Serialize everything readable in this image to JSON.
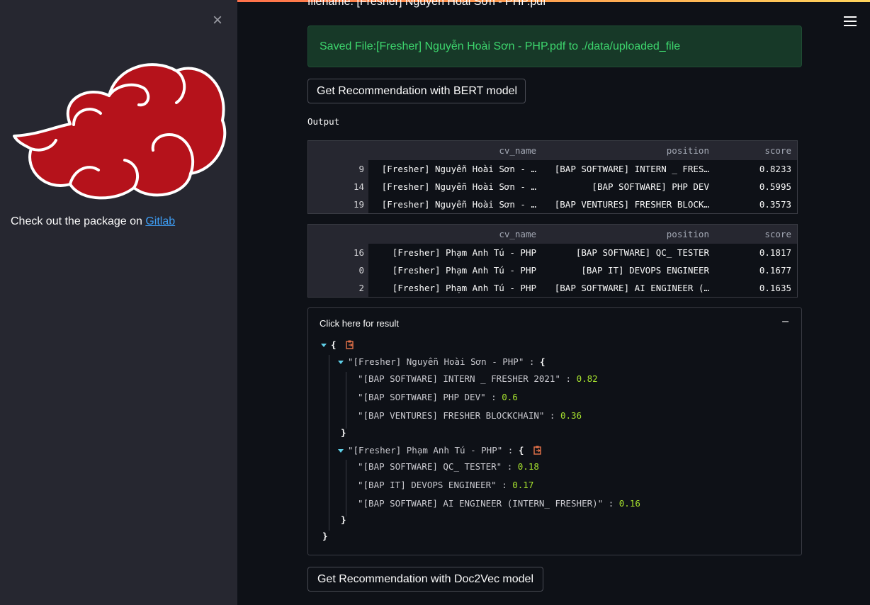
{
  "sidebar": {
    "gitlab_prefix": "Check out the package on ",
    "gitlab_link": "Gitlab"
  },
  "main": {
    "filename": "filename: [Fresher] Nguyễn Hoài Sơn - PHP.pdf",
    "success_message": "Saved File:[Fresher] Nguyễn Hoài Sơn - PHP.pdf to ./data/uploaded_file",
    "bert_button": "Get Recommendation with BERT model",
    "output_label": "Output",
    "doc2vec_button": "Get Recommendation with Doc2Vec model"
  },
  "table_headers": {
    "cv_name": "cv_name",
    "position": "position",
    "score": "score"
  },
  "table1": [
    {
      "idx": "9",
      "cv_name": "[Fresher] Nguyễn Hoài Sơn - …",
      "position": "[BAP SOFTWARE] INTERN _ FRES…",
      "score": "0.8233"
    },
    {
      "idx": "14",
      "cv_name": "[Fresher] Nguyễn Hoài Sơn - …",
      "position": "[BAP SOFTWARE] PHP DEV",
      "score": "0.5995"
    },
    {
      "idx": "19",
      "cv_name": "[Fresher] Nguyễn Hoài Sơn - …",
      "position": "[BAP VENTURES] FRESHER BLOCK…",
      "score": "0.3573"
    }
  ],
  "table2": [
    {
      "idx": "16",
      "cv_name": "[Fresher] Phạm Anh Tú - PHP",
      "position": "[BAP SOFTWARE] QC_ TESTER",
      "score": "0.1817"
    },
    {
      "idx": "0",
      "cv_name": "[Fresher] Phạm Anh Tú - PHP",
      "position": "[BAP IT] DEVOPS ENGINEER",
      "score": "0.1677"
    },
    {
      "idx": "2",
      "cv_name": "[Fresher] Phạm Anh Tú - PHP",
      "position": "[BAP SOFTWARE] AI ENGINEER (…",
      "score": "0.1635"
    }
  ],
  "expander": {
    "label": "Click here for result",
    "toggle": "–",
    "json": {
      "open_brace": "{",
      "close_brace": "}",
      "group1_key": "\"[Fresher] Nguyễn Hoài Sơn - PHP\"",
      "group1_items": [
        {
          "key": "\"[BAP SOFTWARE] INTERN _ FRESHER 2021\"",
          "value": "0.82"
        },
        {
          "key": "\"[BAP SOFTWARE] PHP DEV\"",
          "value": "0.6"
        },
        {
          "key": "\"[BAP VENTURES] FRESHER BLOCKCHAIN\"",
          "value": "0.36"
        }
      ],
      "group2_key": "\"[Fresher] Phạm Anh Tú - PHP\"",
      "group2_items": [
        {
          "key": "\"[BAP SOFTWARE] QC_ TESTER\"",
          "value": "0.18"
        },
        {
          "key": "\"[BAP IT] DEVOPS ENGINEER\"",
          "value": "0.17"
        },
        {
          "key": "\"[BAP SOFTWARE] AI ENGINEER (INTERN_ FRESHER)\"",
          "value": "0.16"
        }
      ],
      "sep": " : "
    }
  },
  "colors": {
    "accent_red": "#ff4b4b",
    "logo_red": "#b5121b",
    "success_green": "#3dd56d",
    "number_green": "#a6e22e",
    "link_blue": "#3d9df3"
  }
}
